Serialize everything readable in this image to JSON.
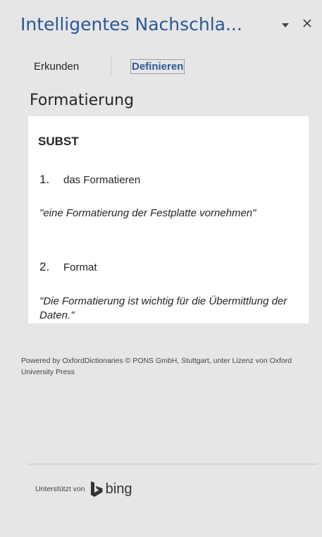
{
  "header": {
    "title": "Intelligentes Nachschla..."
  },
  "icons": {
    "dropdown": "chevron-down-icon",
    "close": "close-icon",
    "bing_logo": "bing-logo-icon"
  },
  "tabs": [
    {
      "label": "Erkunden",
      "active": false
    },
    {
      "label": "Definieren",
      "active": true
    }
  ],
  "entry": {
    "word": "Formatierung",
    "part_of_speech": "SUBST",
    "senses": [
      {
        "number": "1.",
        "definition": "das Formatieren",
        "example": "\"eine Formatierung der Festplatte vornehmen\""
      },
      {
        "number": "2.",
        "definition": "Format",
        "example": "\"Die Formatierung ist wichtig für die Übermittlung der Daten.\""
      }
    ]
  },
  "credit": "Powered by OxfordDictionaries © PONS GmbH, Stuttgart, unter Lizenz von Oxford University Press",
  "footer": {
    "label": "Unterstützt von",
    "brand": "bing"
  },
  "colors": {
    "title_blue": "#2b579a",
    "background": "#e6e6e6",
    "card": "#ffffff"
  }
}
